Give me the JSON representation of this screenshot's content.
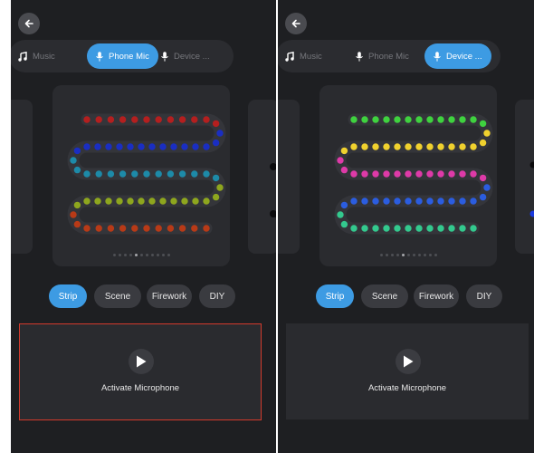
{
  "colors": {
    "accent": "#3d9be3",
    "panel_bg": "#1e1f22",
    "card_bg": "#2a2b2f",
    "highlight_border": "#d33a2c"
  },
  "panels": [
    {
      "back_icon": "arrow-left-icon",
      "tabs": [
        {
          "label": "Music",
          "icon": "music-note-icon",
          "active": false
        },
        {
          "label": "Phone Mic",
          "icon": "microphone-icon",
          "active": true
        },
        {
          "label": "Device ...",
          "icon": "microphone-icon",
          "active": false
        }
      ],
      "preview": {
        "rows": [
          {
            "color": "#b41f1f",
            "count": 11
          },
          {
            "color": "#1a2ec2",
            "count": 12
          },
          {
            "color": "#1d8aa8",
            "count": 11
          },
          {
            "color": "#8ea61e",
            "count": 12
          },
          {
            "color": "#b83a17",
            "count": 11
          }
        ]
      },
      "page_indicator": {
        "count": 11,
        "active_index": 4
      },
      "modes": [
        "Strip",
        "Scene",
        "Firework",
        "DIY"
      ],
      "active_mode": "Strip",
      "mic_card": {
        "button_icon": "play-icon",
        "label": "Activate Microphone",
        "highlighted": true
      }
    },
    {
      "back_icon": "arrow-left-icon",
      "tabs": [
        {
          "label": "Music",
          "icon": "music-note-icon",
          "active": false
        },
        {
          "label": "Phone Mic",
          "icon": "microphone-icon",
          "active": false
        },
        {
          "label": "Device ...",
          "icon": "microphone-icon",
          "active": true
        }
      ],
      "preview": {
        "rows": [
          {
            "color": "#3fd23f",
            "count": 12
          },
          {
            "color": "#f0d12e",
            "count": 12
          },
          {
            "color": "#de3aa8",
            "count": 12
          },
          {
            "color": "#2b5de0",
            "count": 12
          },
          {
            "color": "#33c98e",
            "count": 12
          }
        ]
      },
      "page_indicator": {
        "count": 11,
        "active_index": 4
      },
      "modes": [
        "Strip",
        "Scene",
        "Firework",
        "DIY"
      ],
      "active_mode": "Strip",
      "mic_card": {
        "button_icon": "play-icon",
        "label": "Activate Microphone",
        "highlighted": false
      }
    }
  ]
}
